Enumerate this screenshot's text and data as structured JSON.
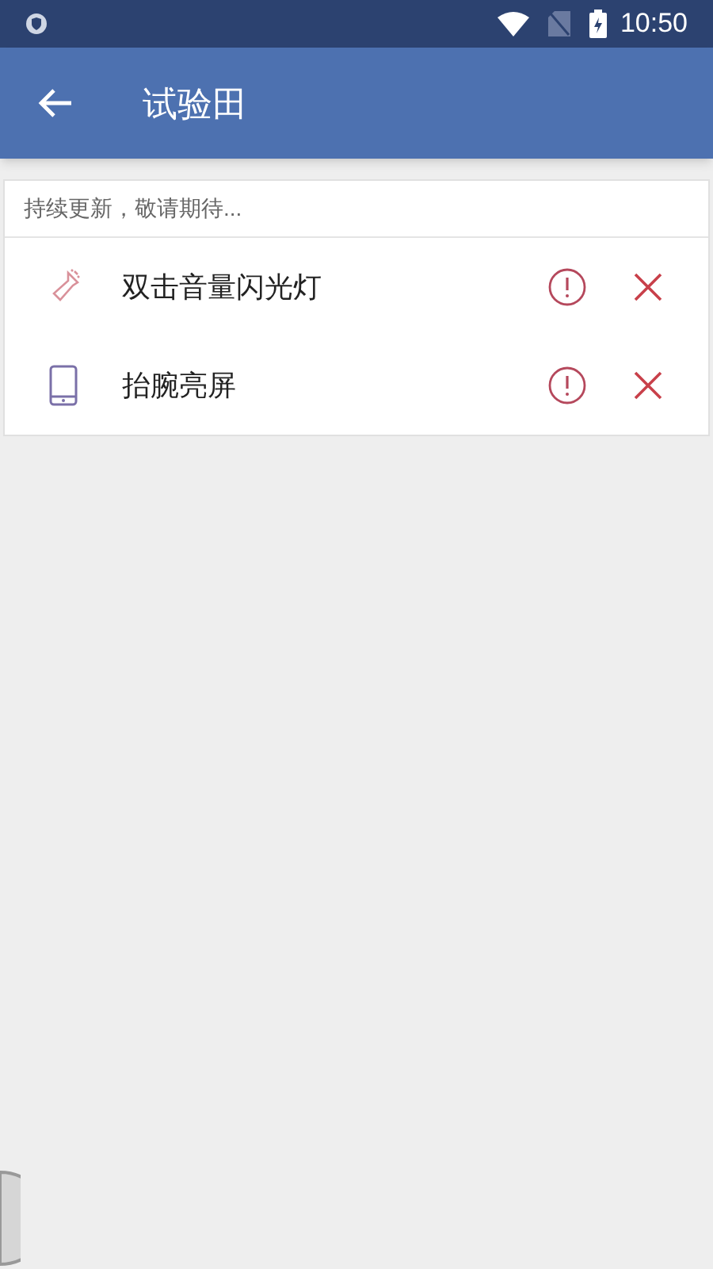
{
  "status_bar": {
    "time": "10:50"
  },
  "app_bar": {
    "title": "试验田"
  },
  "notice": "持续更新，敬请期待...",
  "items": [
    {
      "kind": "flashlight",
      "label": "双击音量闪光灯"
    },
    {
      "kind": "phone",
      "label": "抬腕亮屏"
    }
  ]
}
